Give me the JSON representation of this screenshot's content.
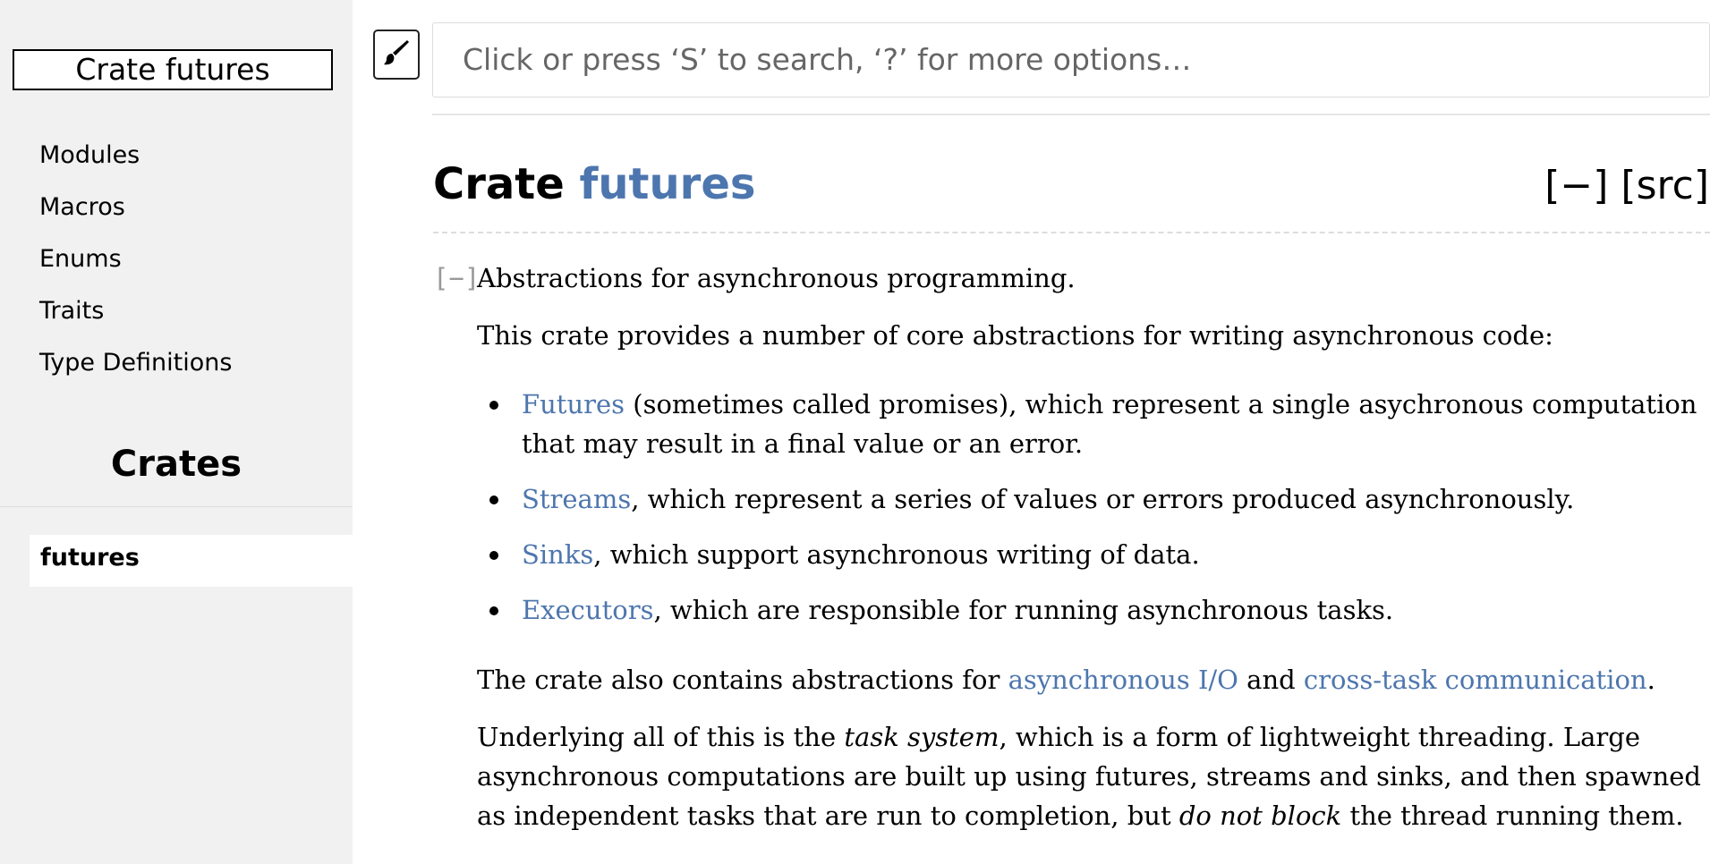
{
  "sidebar": {
    "crate_box": "Crate futures",
    "nav": [
      "Modules",
      "Macros",
      "Enums",
      "Traits",
      "Type Definitions"
    ],
    "crates_heading": "Crates",
    "crates": [
      "futures"
    ]
  },
  "search": {
    "placeholder": "Click or press ‘S’ to search, ‘?’ for more options…"
  },
  "header": {
    "title_prefix": "Crate ",
    "title_name": "futures",
    "collapse_all": "[−]",
    "src": "[src]"
  },
  "doc": {
    "toggle": "[−]",
    "summary": "Abstractions for asynchronous programming.",
    "para1": "This crate provides a number of core abstractions for writing asynchronous code:",
    "bullets": [
      {
        "link": "Futures",
        "text": " (sometimes called promises), which represent a single asychronous computation that may result in a final value or an error."
      },
      {
        "link": "Streams",
        "text": ", which represent a series of values or errors produced asynchronously."
      },
      {
        "link": "Sinks",
        "text": ", which support asynchronous writing of data."
      },
      {
        "link": "Executors",
        "text": ", which are responsible for running asynchronous tasks."
      }
    ],
    "para2": {
      "pre": "The crate also contains abstractions for ",
      "link1": "asynchronous I/O",
      "mid": " and ",
      "link2": "cross-task communication",
      "post": "."
    },
    "para3": {
      "pre": "Underlying all of this is the ",
      "em1": "task system",
      "mid": ", which is a form of lightweight threading. Large asynchronous computations are built up using futures, streams and sinks, and then spawned as independent tasks that are run to completion, but ",
      "em2": "do not block",
      "post": " the thread running them."
    }
  },
  "colors": {
    "link": "#4d76ae",
    "sidebar_bg": "#f1f1f1"
  }
}
